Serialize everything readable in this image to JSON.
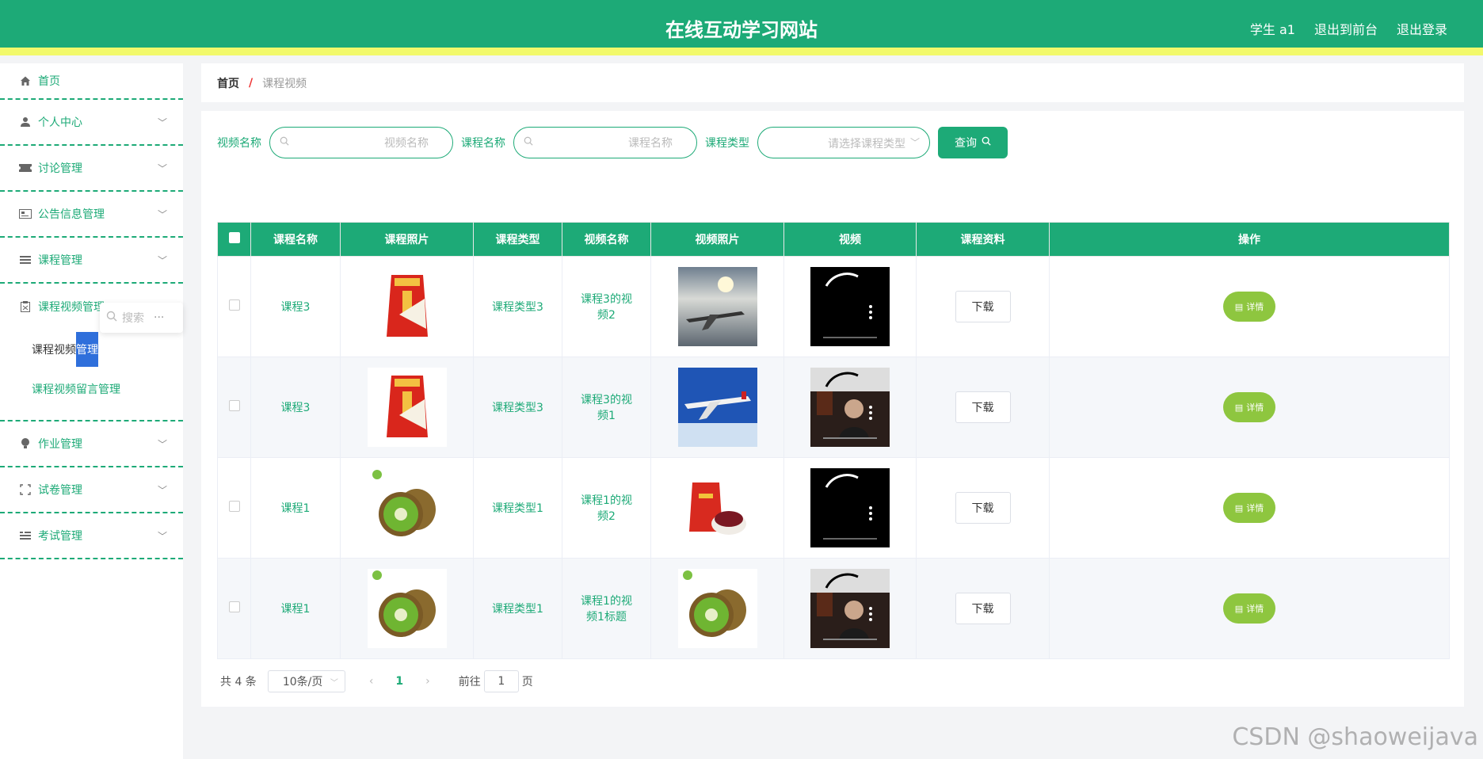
{
  "header": {
    "title": "在线互动学习网站",
    "user": "学生 a1",
    "to_front": "退出到前台",
    "logout": "退出登录"
  },
  "sidebar": {
    "items": [
      {
        "label": "首页",
        "icon": "home-icon"
      },
      {
        "label": "个人中心",
        "icon": "user-icon"
      },
      {
        "label": "讨论管理",
        "icon": "ticket-icon"
      },
      {
        "label": "公告信息管理",
        "icon": "notice-icon"
      },
      {
        "label": "课程管理",
        "icon": "list-icon"
      },
      {
        "label": "课程视频管理",
        "icon": "clipboard-icon"
      },
      {
        "label": "作业管理",
        "icon": "bulb-icon"
      },
      {
        "label": "试卷管理",
        "icon": "scan-icon"
      },
      {
        "label": "考试管理",
        "icon": "menu-icon"
      }
    ],
    "sub_items": [
      "课程视频管理",
      "课程视频留言管理"
    ],
    "sub_active_pre": "课程视频",
    "sub_active_hl": "管理",
    "popup_search": "搜索"
  },
  "breadcrumb": {
    "home": "首页",
    "sep": "/",
    "current": "课程视频"
  },
  "filters": {
    "video_name_label": "视频名称",
    "video_name_placeholder": "视频名称",
    "course_name_label": "课程名称",
    "course_name_placeholder": "课程名称",
    "course_type_label": "课程类型",
    "course_type_placeholder": "请选择课程类型",
    "query_button": "查询"
  },
  "table": {
    "headers": [
      "课程名称",
      "课程照片",
      "课程类型",
      "视频名称",
      "视频照片",
      "视频",
      "课程资料",
      "操作"
    ],
    "rows": [
      {
        "course": "课程3",
        "course_img": "rice-bag",
        "type": "课程类型3",
        "video": "课程3的视频2",
        "video_img": "plane-sunset",
        "video_thumb": "video-dark"
      },
      {
        "course": "课程3",
        "course_img": "rice-bag",
        "type": "课程类型3",
        "video": "课程3的视频1",
        "video_img": "plane-blue",
        "video_thumb": "video-person"
      },
      {
        "course": "课程1",
        "course_img": "kiwi",
        "type": "课程类型1",
        "video": "课程1的视频2",
        "video_img": "red-bag",
        "video_thumb": "video-dark"
      },
      {
        "course": "课程1",
        "course_img": "kiwi",
        "type": "课程类型1",
        "video": "课程1的视频1标题",
        "video_img": "kiwi",
        "video_thumb": "video-person"
      }
    ],
    "download_label": "下载",
    "detail_label": "详情"
  },
  "pager": {
    "total": "共 4 条",
    "page_size": "10条/页",
    "current": "1",
    "goto_prefix": "前往",
    "goto_value": "1",
    "goto_suffix": "页"
  },
  "watermark": "CSDN @shaoweijava",
  "colors": {
    "primary": "#1daa77",
    "accent_yellow": "#f2f96b",
    "detail_green": "#8ec63f"
  }
}
